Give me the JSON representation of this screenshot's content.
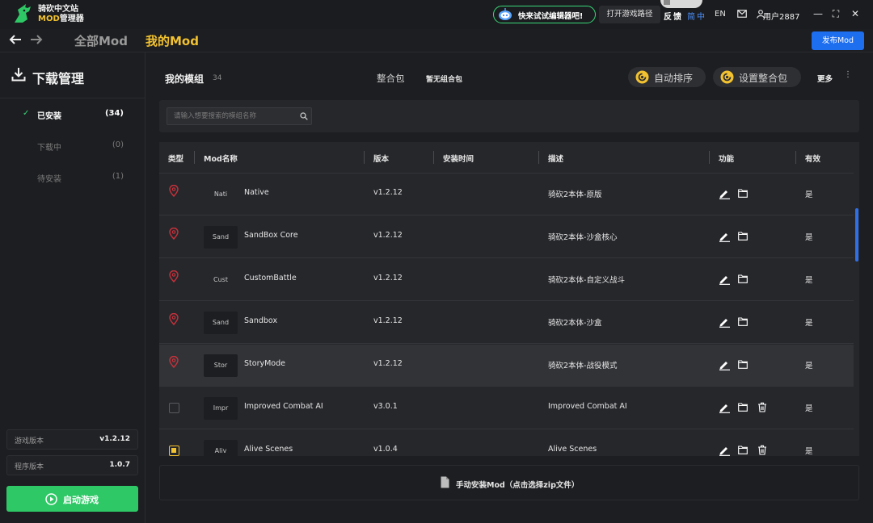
{
  "app": {
    "brand_line1": "骑砍中文站",
    "brand_line2_prefix": "MOD",
    "brand_line2_suffix": "管理器",
    "accent": "#f2c230",
    "primary": "#1e6ef0",
    "success": "#2fc866"
  },
  "topbar": {
    "promo": "快来试试编辑器吧!",
    "open_path": "打开游戏路径",
    "feedback": "反馈",
    "lang_zh": "简中",
    "lang_en": "EN",
    "username": "用户2887",
    "minimize": "—",
    "maximize": "⛶",
    "close": "✕"
  },
  "nav": {
    "back_icon": "arrow-left-icon",
    "forward_icon": "arrow-right-icon",
    "tab_all": "全部Mod",
    "tab_mine": "我的Mod",
    "publish": "发布Mod"
  },
  "sidebar": {
    "title": "下载管理",
    "items": [
      {
        "label": "已安装",
        "count": "(34)",
        "check": "✓"
      },
      {
        "label": "下载中",
        "count": "(0)"
      },
      {
        "label": "待安装",
        "count": "(1)"
      }
    ],
    "game_version_label": "游戏版本",
    "game_version": "v1.2.12",
    "app_version_label": "程序版本",
    "app_version": "1.0.7",
    "launch": "启动游戏"
  },
  "main": {
    "title": "我的模组",
    "count": "34",
    "bundle_label": "整合包",
    "bundle_value": "暂无组合包",
    "auto_sort": "自动排序",
    "set_bundle": "设置整合包",
    "more": "更多",
    "more_dots": "⋮",
    "search_placeholder": "请输入想要搜索的模组名称"
  },
  "table": {
    "headers": {
      "type": "类型",
      "name": "Mod名称",
      "version": "版本",
      "install_time": "安装时间",
      "desc": "描述",
      "function": "功能",
      "enabled": "有效"
    },
    "rows": [
      {
        "thumb": "Nati",
        "name": "Native",
        "version": "v1.2.12",
        "desc": "骑砍2本体-原版",
        "enabled": "是"
      },
      {
        "thumb": "Sand",
        "name": "SandBox Core",
        "version": "v1.2.12",
        "desc": "骑砍2本体-沙盒核心",
        "enabled": "是"
      },
      {
        "thumb": "Cust",
        "name": "CustomBattle",
        "version": "v1.2.12",
        "desc": "骑砍2本体-自定义战斗",
        "enabled": "是"
      },
      {
        "thumb": "Sand",
        "name": "Sandbox",
        "version": "v1.2.12",
        "desc": "骑砍2本体-沙盒",
        "enabled": "是"
      },
      {
        "thumb": "Stor",
        "name": "StoryMode",
        "version": "v1.2.12",
        "desc": "骑砍2本体-战役模式",
        "enabled": "是"
      },
      {
        "thumb": "Impr",
        "name": "Improved Combat AI",
        "version": "v3.0.1",
        "desc": "Improved Combat AI",
        "enabled": "是"
      },
      {
        "thumb": "Aliv",
        "name": "Alive Scenes",
        "version": "v1.0.4",
        "desc": "Alive Scenes",
        "enabled": "是"
      }
    ]
  },
  "footer": {
    "label": "手动安装Mod（点击选择zip文件）"
  }
}
